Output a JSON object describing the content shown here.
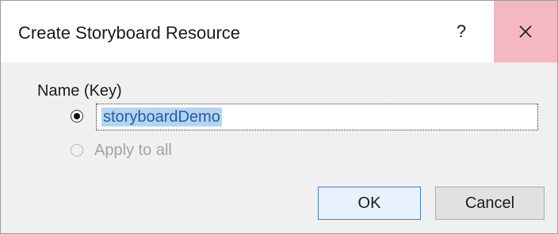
{
  "window": {
    "title": "Create Storyboard Resource",
    "help_label": "?",
    "close_icon": "close-icon"
  },
  "form": {
    "name_label": "Name (Key)",
    "key_option": {
      "selected": true
    },
    "key_input": {
      "value": "storyboardDemo",
      "text_selected": true
    },
    "apply_option": {
      "label": "Apply to all",
      "selected": false,
      "enabled": false
    }
  },
  "buttons": {
    "ok_label": "OK",
    "cancel_label": "Cancel"
  },
  "colors": {
    "close_hover": "#f4b8c0",
    "selection": "#b5d4f1",
    "default_button_border": "#3c7fd1"
  }
}
